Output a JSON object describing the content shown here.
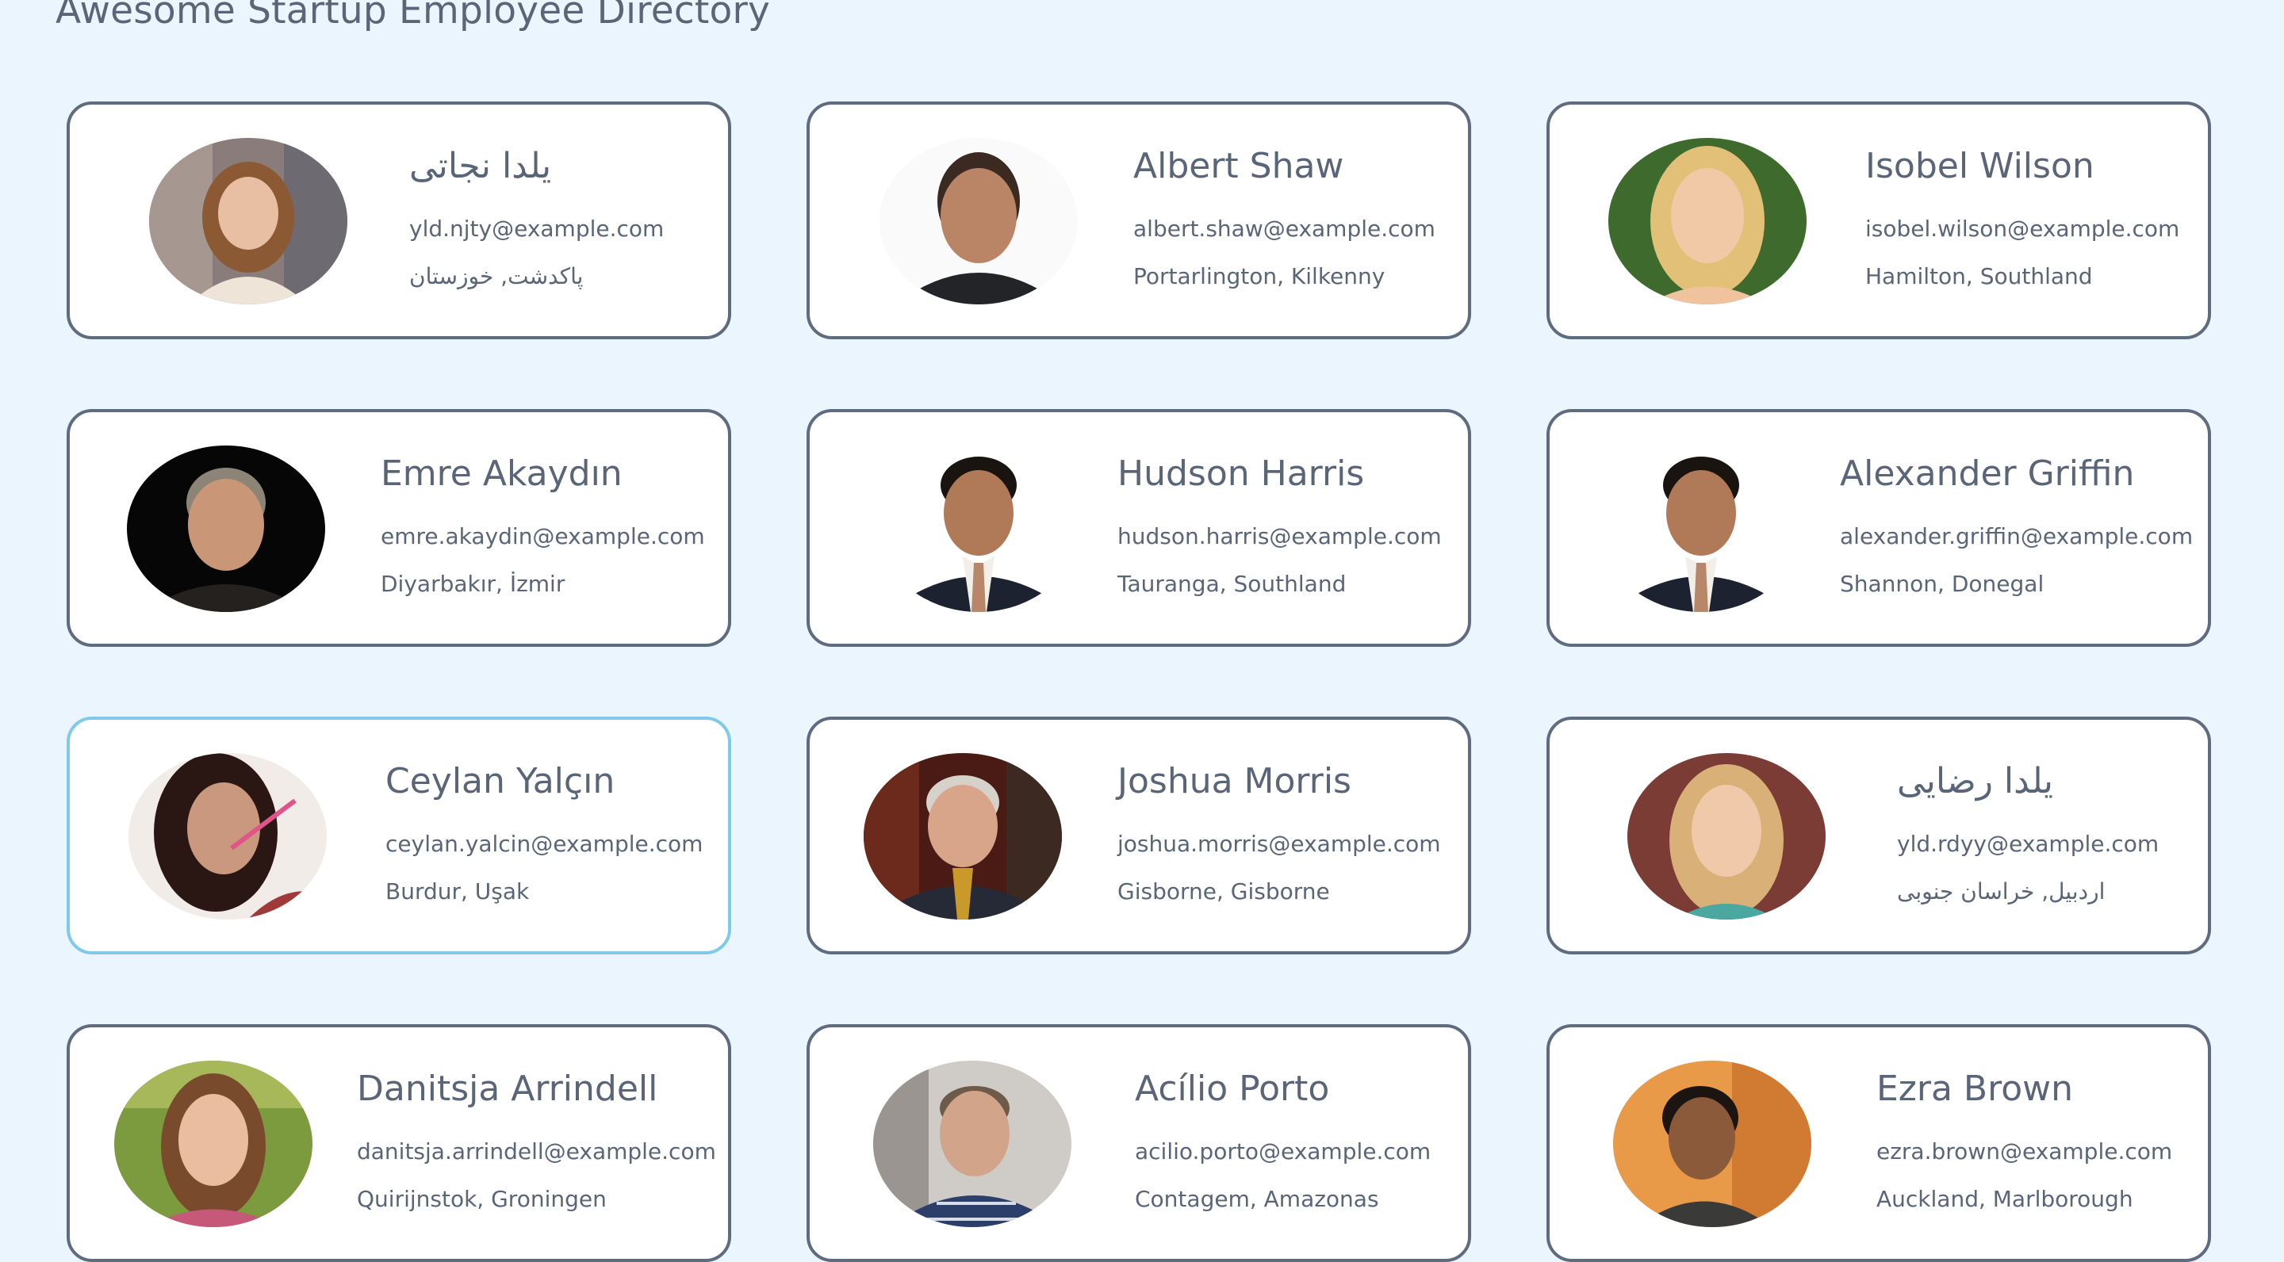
{
  "page": {
    "title": "Awesome Startup Employee Directory"
  },
  "employees": [
    {
      "name": "یلدا نجاتی",
      "email": "yld.njty@example.com",
      "location": "پاکدشت, خوزستان",
      "avatar": "woman-light-brown-hair-icon"
    },
    {
      "name": "Albert Shaw",
      "email": "albert.shaw@example.com",
      "location": "Portarlington, Kilkenny",
      "avatar": "man-dark-hair-icon"
    },
    {
      "name": "Isobel Wilson",
      "email": "isobel.wilson@example.com",
      "location": "Hamilton, Southland",
      "avatar": "woman-blonde-icon"
    },
    {
      "name": "Emre Akaydın",
      "email": "emre.akaydin@example.com",
      "location": "Diyarbakır, İzmir",
      "avatar": "man-grey-hair-icon"
    },
    {
      "name": "Hudson Harris",
      "email": "hudson.harris@example.com",
      "location": "Tauranga, Southland",
      "avatar": "man-suit-tie-icon"
    },
    {
      "name": "Alexander Griffin",
      "email": "alexander.griffin@example.com",
      "location": "Shannon, Donegal",
      "avatar": "man-suit-tie-icon"
    },
    {
      "name": "Ceylan Yalçın",
      "email": "ceylan.yalcin@example.com",
      "location": "Burdur, Uşak",
      "avatar": "woman-dark-hair-icon"
    },
    {
      "name": "Joshua Morris",
      "email": "joshua.morris@example.com",
      "location": "Gisborne, Gisborne",
      "avatar": "man-suit-gold-tie-icon"
    },
    {
      "name": "یلدا رضایی",
      "email": "yld.rdyy@example.com",
      "location": "اردبیل, خراسان جنوبی",
      "avatar": "woman-blonde-icon"
    },
    {
      "name": "Danitsja Arrindell",
      "email": "danitsja.arrindell@example.com",
      "location": "Quirijnstok, Groningen",
      "avatar": "woman-brown-hair-icon"
    },
    {
      "name": "Acílio Porto",
      "email": "acilio.porto@example.com",
      "location": "Contagem, Amazonas",
      "avatar": "man-checked-shirt-icon"
    },
    {
      "name": "Ezra Brown",
      "email": "ezra.brown@example.com",
      "location": "Auckland, Marlborough",
      "avatar": "man-dark-skin-icon"
    }
  ],
  "colors": {
    "background": "#eaf5fd",
    "card_border": "#5f6b7e",
    "card_border_focused": "#7ecae7",
    "text": "#5a6578"
  }
}
